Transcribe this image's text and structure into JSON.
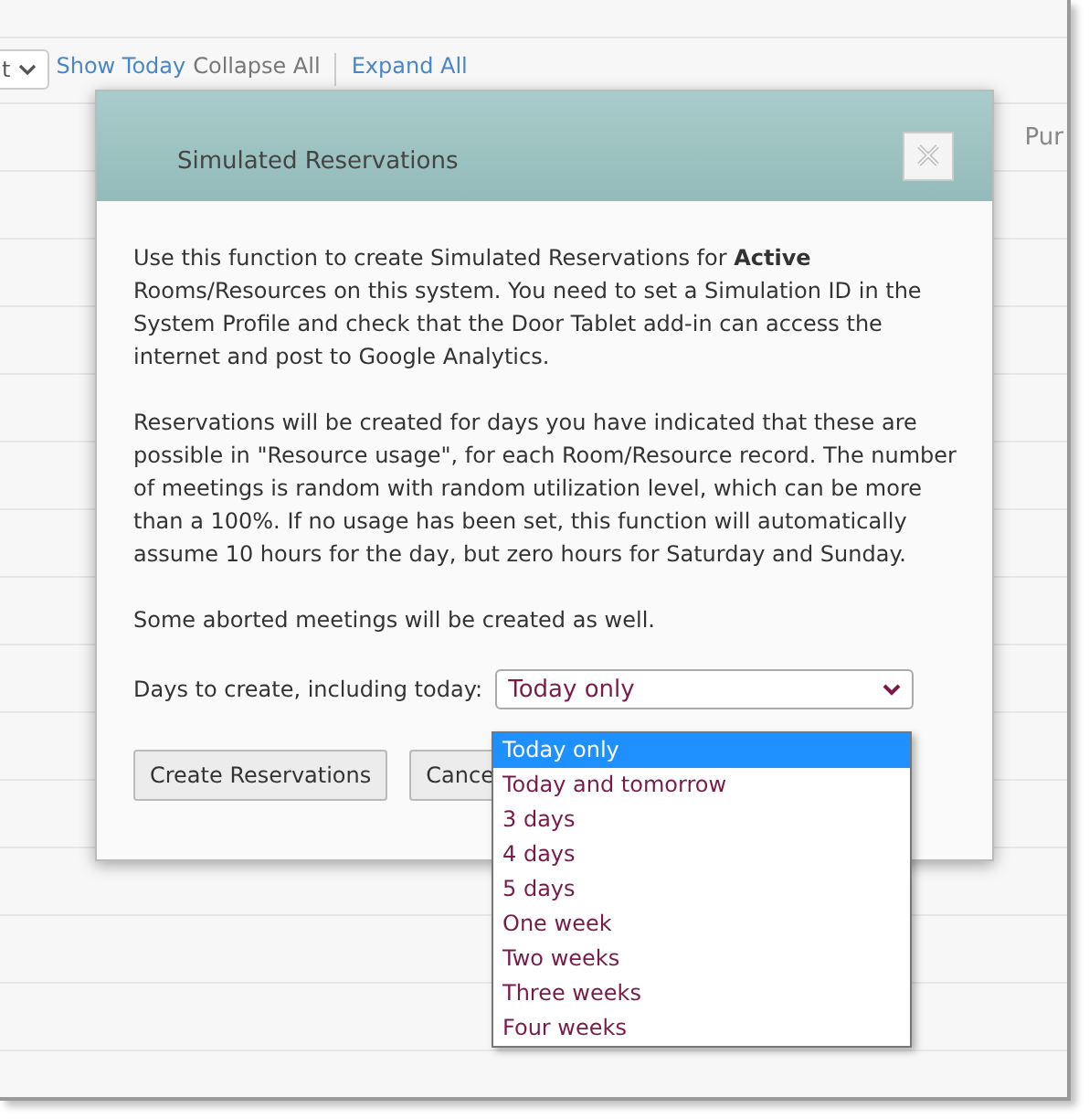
{
  "toolbar": {
    "select_value": "t",
    "links": [
      {
        "label": "Show Today",
        "kind": "link"
      },
      {
        "label": "Collapse All",
        "kind": "plain"
      },
      {
        "label": "Expand All",
        "kind": "link"
      }
    ]
  },
  "table": {
    "column_header": "Pur"
  },
  "dialog": {
    "title": "Simulated Reservations",
    "paragraphs": [
      "Use this function to create Simulated Reservations for  **Active** Rooms/Resources on this system.  You need to set a Simulation ID in the System Profile and check that the Door Tablet add-in can access the internet and post to Google Analytics.",
      "Reservations will be created for days you have indicated that these are possible in \"Resource usage\", for each Room/Resource record.  The number of meetings is random with random utilization level, which can be more than a 100%.  If no usage has been set, this function will automatically assume 10 hours for the day, but zero hours for Saturday and Sunday.",
      "Some aborted meetings will be created as well."
    ],
    "field_label": "Days to create, including today:",
    "select_value": "Today only",
    "options": [
      {
        "label": "Today only",
        "selected": true
      },
      {
        "label": "Today and tomorrow",
        "selected": false
      },
      {
        "label": "3 days",
        "selected": false
      },
      {
        "label": "4 days",
        "selected": false
      },
      {
        "label": "5 days",
        "selected": false
      },
      {
        "label": "One week",
        "selected": false
      },
      {
        "label": "Two weeks",
        "selected": false
      },
      {
        "label": "Three weeks",
        "selected": false
      },
      {
        "label": "Four weeks",
        "selected": false
      }
    ],
    "buttons": [
      "Create Reservations",
      "Cance"
    ]
  }
}
